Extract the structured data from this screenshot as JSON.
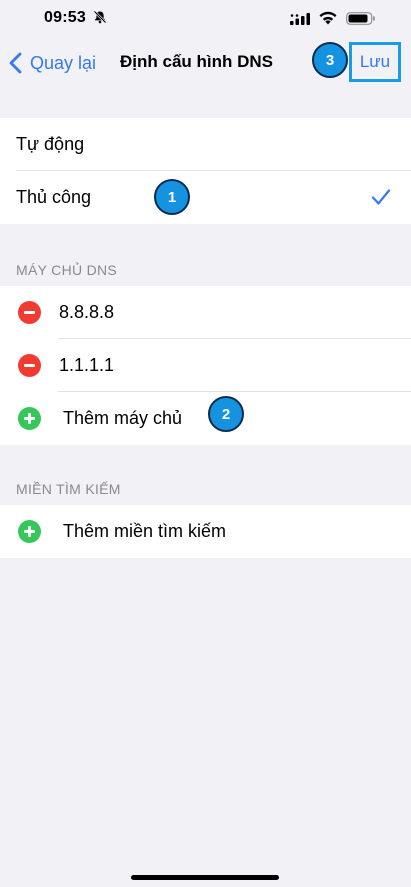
{
  "status_bar": {
    "time": "09:53"
  },
  "nav": {
    "back_label": "Quay lại",
    "title": "Định cấu hình DNS",
    "save_label": "Lưu"
  },
  "mode_options": [
    {
      "label": "Tự động",
      "selected": false
    },
    {
      "label": "Thủ công",
      "selected": true
    }
  ],
  "dns_section": {
    "header": "MÁY CHỦ DNS",
    "servers": [
      "8.8.8.8",
      "1.1.1.1"
    ],
    "add_label": "Thêm máy chủ"
  },
  "search_section": {
    "header": "MIỀN TÌM KIẾM",
    "add_label": "Thêm miền tìm kiếm"
  },
  "annotations": [
    "1",
    "2",
    "3"
  ],
  "colors": {
    "accent": "#3478f6",
    "delete": "#f13b30",
    "add": "#34c759",
    "badge": "#1592e0",
    "background": "#f2f1f6"
  }
}
